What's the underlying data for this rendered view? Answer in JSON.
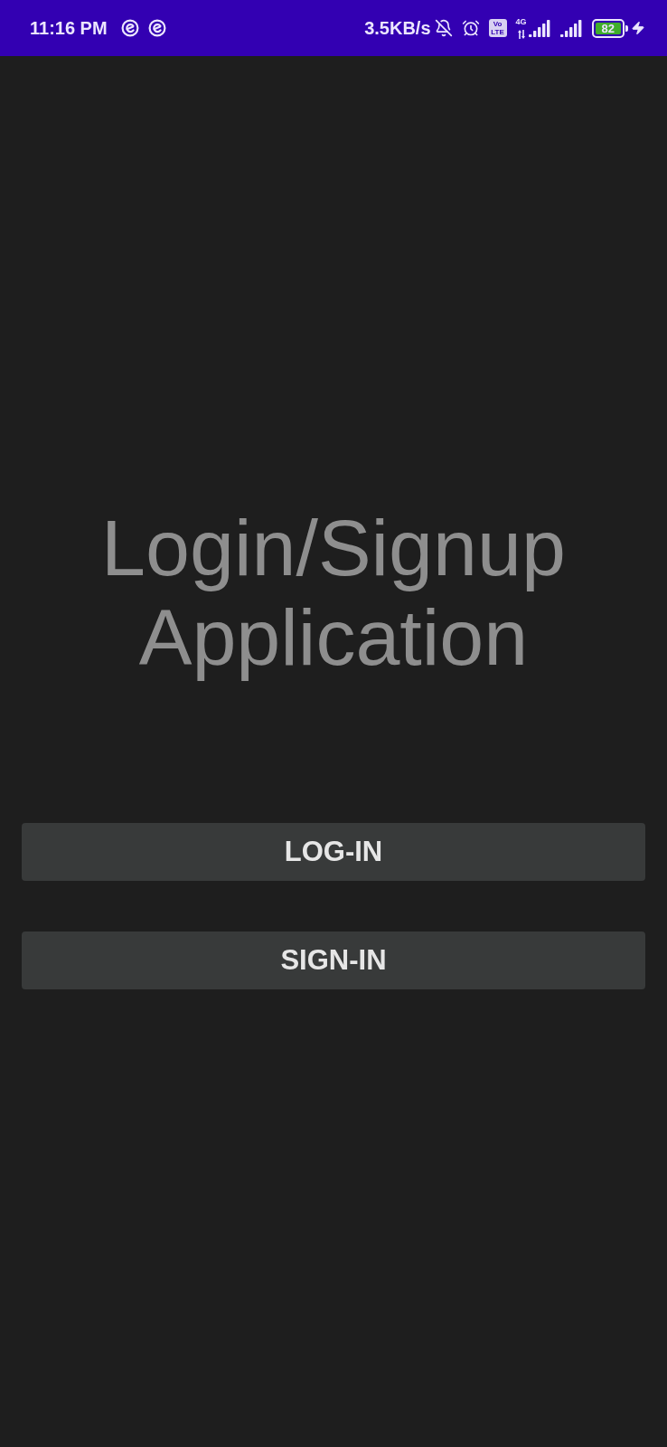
{
  "status_bar": {
    "time": "11:16 PM",
    "network_speed": "3.5KB/s",
    "volte": "Vo LTE",
    "network_type": "4G",
    "battery": "82"
  },
  "title": "Login/Signup Application",
  "buttons": [
    {
      "label": "LOG-IN"
    },
    {
      "label": "SIGN-IN"
    }
  ]
}
